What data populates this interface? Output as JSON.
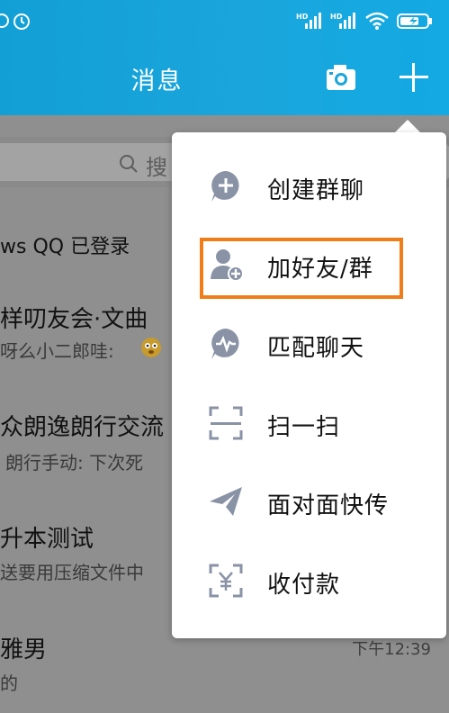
{
  "header": {
    "title": "消息"
  },
  "search": {
    "placeholder": "搜"
  },
  "list": [
    {
      "name": "ws QQ 已登录",
      "message": "",
      "time": ""
    },
    {
      "name": "样叨友会·文曲",
      "message": "呀么小二郎哇:",
      "time": ""
    },
    {
      "name": "众朗逸朗行交流",
      "message": "朗行手动: 下次死",
      "time": ""
    },
    {
      "name": "升本测试",
      "message": "送要用压缩文件中",
      "time": ""
    },
    {
      "name": "雅男",
      "message": "的",
      "time": "下午12:39"
    }
  ],
  "menu": {
    "items": [
      {
        "label": "创建群聊",
        "icon": "create-group-icon"
      },
      {
        "label": "加好友/群",
        "icon": "add-friend-icon"
      },
      {
        "label": "匹配聊天",
        "icon": "match-chat-icon"
      },
      {
        "label": "扫一扫",
        "icon": "scan-icon"
      },
      {
        "label": "面对面快传",
        "icon": "face-to-face-transfer-icon"
      },
      {
        "label": "收付款",
        "icon": "payment-icon"
      }
    ]
  },
  "colors": {
    "header": "#1aa6dc",
    "highlight": "#f07d18",
    "icon": "#8a93a6"
  }
}
